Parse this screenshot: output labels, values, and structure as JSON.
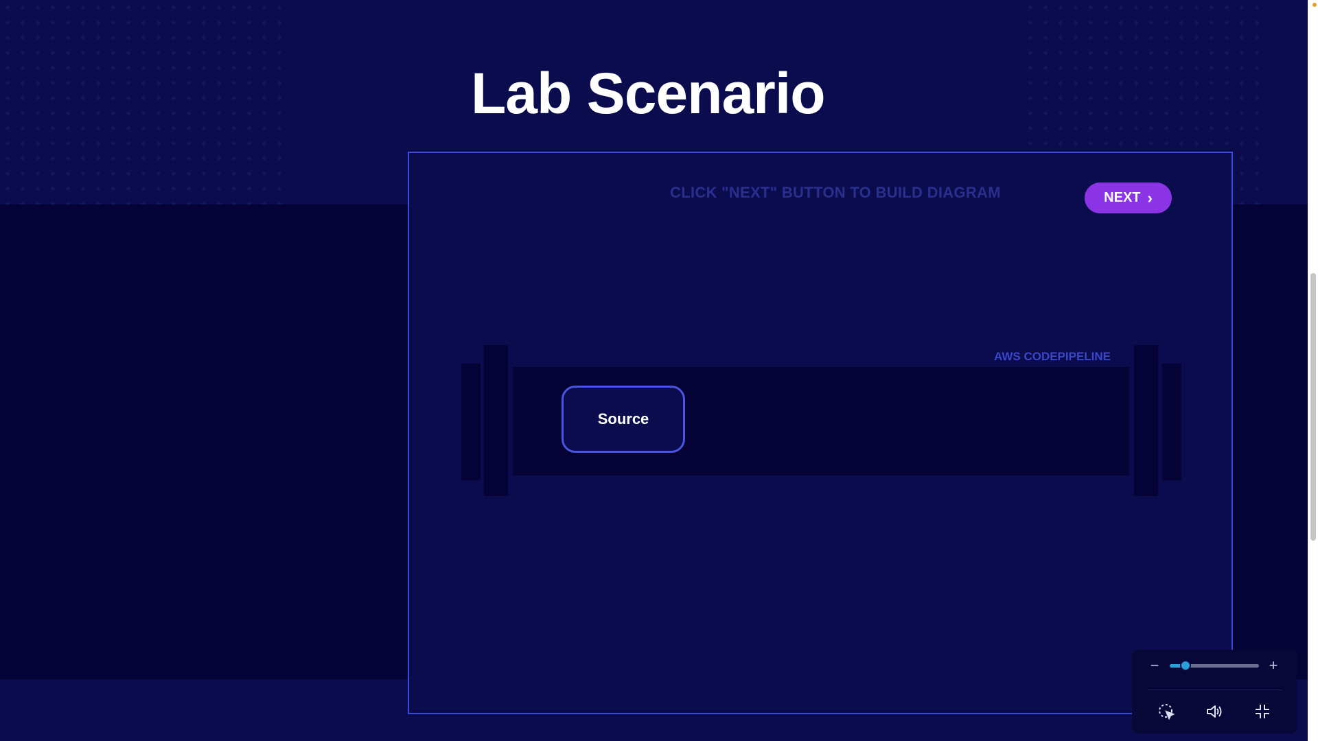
{
  "title": "Lab Scenario",
  "instruction": "CLICK \"NEXT\" BUTTON TO BUILD DIAGRAM",
  "next_button": {
    "label": "NEXT",
    "chevron": "›",
    "color": "#8a34e6"
  },
  "pipeline": {
    "label": "AWS CODEPIPELINE",
    "stages": [
      "Source"
    ]
  },
  "controls": {
    "zoom_minus": "−",
    "zoom_plus": "+",
    "zoom_level_fraction": 0.18,
    "icons": [
      "cursor-icon",
      "volume-icon",
      "collapse-icon"
    ]
  },
  "colors": {
    "background": "#0a0c4e",
    "dark_band": "#050236",
    "frame_border": "#3d4ad6",
    "accent": "#8a34e6",
    "slider": "#2a9fd6"
  }
}
